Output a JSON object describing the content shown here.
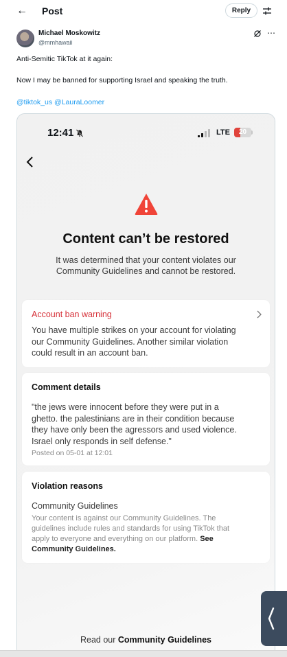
{
  "header": {
    "title": "Post",
    "reply_label": "Reply"
  },
  "author": {
    "name": "Michael Moskowitz",
    "handle": "@mmhawaii"
  },
  "tweet": {
    "line1": "Anti-Semitic TikTok at it again:",
    "line2": "Now I may be banned for supporting Israel and speaking the truth.",
    "mention1": "@tiktok_us",
    "mention2": "@LauraLoomer"
  },
  "screenshot": {
    "status": {
      "time": "12:41",
      "network": "LTE",
      "battery": "20"
    },
    "title": "Content can’t be restored",
    "subtitle_line1": "It was determined that your content violates our",
    "subtitle_line2": "Community Guidelines and cannot be restored.",
    "ban_card": {
      "title": "Account ban warning",
      "line1": "You have multiple strikes on your account for violating",
      "line2": "our Community Guidelines. Another similar violation",
      "line3": "could result in an account ban."
    },
    "comment_card": {
      "title": "Comment details",
      "line1": "\"the jews were innocent before they were put in a",
      "line2": "ghetto. the palestinians are in their condition because",
      "line3": "they have only been the agressors and used violence.",
      "line4": "Israel only responds in self defense.\"",
      "posted": "Posted on 05-01 at 12:01"
    },
    "violation_card": {
      "title": "Violation reasons",
      "reason": "Community Guidelines",
      "line1": "Your content is against our Community Guidelines. The",
      "line2": "guidelines include rules and standards for using TikTok that",
      "line3_text": "apply to everyone and everything on our platform. ",
      "line3_bold": "See",
      "line4_bold": "Community Guidelines."
    },
    "footer_text": "Read our ",
    "footer_bold": "Community Guidelines"
  },
  "colors": {
    "link": "#1d9bf0",
    "warning_red": "#d6323a",
    "icon_red": "#f04438"
  }
}
